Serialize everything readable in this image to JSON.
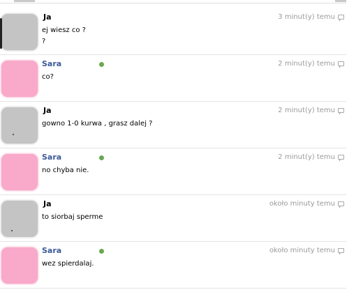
{
  "messages": [
    {
      "author": "Ja",
      "lines": [
        "ej wiesz co ?",
        "?"
      ],
      "time": "3 minut(y) temu",
      "online": false
    },
    {
      "author": "Sara",
      "lines": [
        "co?"
      ],
      "time": "2 minut(y) temu",
      "online": true
    },
    {
      "author": "Ja",
      "lines": [
        "gowno 1-0 kurwa , grasz dalej ?"
      ],
      "time": "2 minut(y) temu",
      "online": false
    },
    {
      "author": "Sara",
      "lines": [
        "no chyba nie."
      ],
      "time": "2 minut(y) temu",
      "online": true
    },
    {
      "author": "Ja",
      "lines": [
        "to siorbaj sperme"
      ],
      "time": "około minuty temu",
      "online": false
    },
    {
      "author": "Sara",
      "lines": [
        "wez spierdalaj."
      ],
      "time": "około minuty temu",
      "online": true
    }
  ],
  "colors": {
    "me_avatar": "#c4c4c4",
    "friend_avatar": "#f9a9c9",
    "friend_name": "#3b5998",
    "online_dot": "#6aa84f",
    "timestamp": "#9a9a9a"
  },
  "icons": {
    "online": "online-status-dot-icon",
    "reply": "reply-speech-bubble-icon"
  }
}
